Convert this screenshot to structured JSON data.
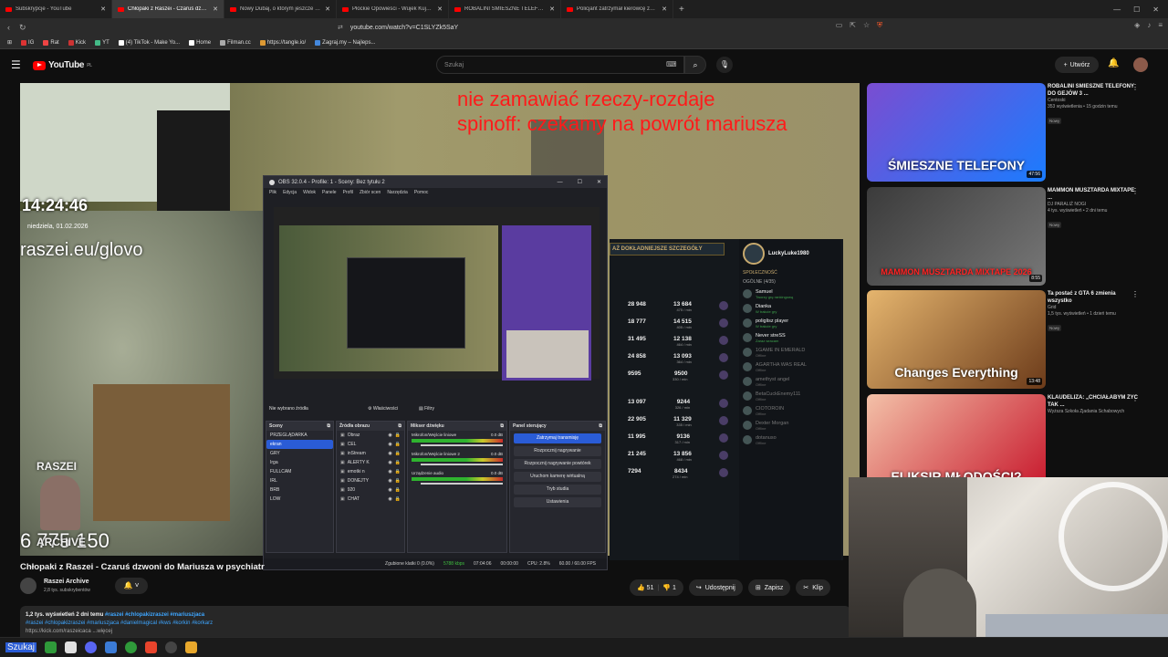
{
  "browser": {
    "tabs": [
      {
        "title": "Subskrypcje - YouTube",
        "active": false
      },
      {
        "title": "Chłopaki z Raszei - Czaruś dzwoni",
        "active": true
      },
      {
        "title": "Nowy Dubaj, o którym jeszcze nie sł",
        "active": false
      },
      {
        "title": "Płockie Opowieści - Wujek Kujek - Yo",
        "active": false
      },
      {
        "title": "ROBALINI ŚMIESZNE TELEFONY DO",
        "active": false
      },
      {
        "title": "Policjant zatrzymał kierowcę za prędk",
        "active": false
      }
    ],
    "url": "youtube.com/watch?v=C1SLYZk5SaY",
    "bookmarks": [
      "IG",
      "Rat",
      "Kick",
      "YT",
      "(4) TikTok - Make Yo...",
      "Home",
      "Filman.cc",
      "https://tangle.io/",
      "Zagraj.my – Najleps..."
    ]
  },
  "youtube": {
    "logo": "YouTube",
    "logo_region": "PL",
    "search_placeholder": "Szukaj",
    "create_label": "Utwórz"
  },
  "stream_overlay": {
    "line1": "nie zamawiać rzeczy-rozdaje",
    "line2": "spinoff: czekamy na powrót mariusza",
    "time": "14:24:46",
    "date": "niedziela, 01.02.2026",
    "site": "raszei.eu/glovo",
    "streamer": "RASZEI",
    "archive": "ARCHIVE",
    "counter": "6 775 150"
  },
  "obs": {
    "title": "OBS 32.0.4 - Profile: 1 - Sceny: Bez tytułu 2",
    "menu": [
      "Plik",
      "Edycja",
      "Widok",
      "Panele",
      "Profil",
      "Zbiór scen",
      "Narzędzia",
      "Pomoc"
    ],
    "no_source": "Nie wybrano źródła",
    "properties": "Właściwości",
    "filters": "Filtry",
    "docks": {
      "scenes": "Sceny",
      "sources": "Źródła obrazu",
      "mixer": "Mikser dźwięku",
      "controls": "Panel sterujący"
    },
    "scenes": [
      "PRZEGLĄDARKA",
      "ekran",
      "GRY",
      "Irga",
      "FULLCAM",
      "IRL",
      "BRB",
      "LOW"
    ],
    "sources": [
      "Obraz",
      "CEL",
      "inStream",
      "ALERTY K",
      "emotki n",
      "DONEJTY",
      "920",
      "CHAT"
    ],
    "mixer": [
      {
        "name": "Mikrofon/Wejście liniowe",
        "db": "0.0 dB"
      },
      {
        "name": "Mikrofon/Wejście liniowe 2",
        "db": "0.0 dB"
      },
      {
        "name": "Urządzenie audio",
        "db": "0.0 dB"
      }
    ],
    "controls": [
      "Zatrzymaj transmisję",
      "Rozpocznij nagrywanie",
      "Rozpocznij nagrywanie powtórek",
      "Uruchom kamerę wirtualną",
      "Tryb studia",
      "Ustawienia"
    ],
    "status": {
      "dropped": "Zgubione klatki 0 (0.0%)",
      "bitrate": "5788 kbps",
      "live": "07:04:06",
      "rec": "00:00:00",
      "cpu": "CPU: 2.8%",
      "fps": "60.00 / 60.00 FPS"
    }
  },
  "game": {
    "banner": "AŻ DOKŁADNIEJSZE SZCZEGÓŁY",
    "user": "LuckyLuke1980",
    "rows": [
      {
        "a": "28 948",
        "b": "13 684",
        "s": "475 / min"
      },
      {
        "a": "18 777",
        "b": "14 515",
        "s": "405 / min"
      },
      {
        "a": "31 495",
        "b": "12 138",
        "s": "464 / min"
      },
      {
        "a": "24 858",
        "b": "13 093",
        "s": "364 / min"
      },
      {
        "a": "9595",
        "b": "9500",
        "s": "330 / min"
      },
      {
        "a": "13 097",
        "b": "9244",
        "s": "326 / min"
      },
      {
        "a": "22 905",
        "b": "11 329",
        "s": "335 / min"
      },
      {
        "a": "11 995",
        "b": "9136",
        "s": "317 / min"
      },
      {
        "a": "21 245",
        "b": "13 856",
        "s": "468 / min"
      },
      {
        "a": "7294",
        "b": "8434",
        "s": "274 / min"
      }
    ],
    "friends_header": "SPOŁECZNOŚĆ",
    "friends_group": "OGÓLNE (4/35)",
    "friends": [
      {
        "name": "Samuel",
        "status": "Tworzy grę rankingową",
        "on": true
      },
      {
        "name": "Dianka",
        "status": "W trakcie gry",
        "on": true
      },
      {
        "name": "poliglisz player",
        "status": "W trakcie gry",
        "on": true
      },
      {
        "name": "Never streSS",
        "status": "Zaraz wracam",
        "on": true
      },
      {
        "name": "1GAME IN EMERALD",
        "status": "Offline",
        "on": false
      },
      {
        "name": "AGARTHA WAS REAL",
        "status": "Offline",
        "on": false
      },
      {
        "name": "amethyst angel",
        "status": "Offline",
        "on": false
      },
      {
        "name": "BetaCuckEnemy111",
        "status": "Offline",
        "on": false
      },
      {
        "name": "CIOTOROIN",
        "status": "Offline",
        "on": false
      },
      {
        "name": "Dexter Morgan",
        "status": "Offline",
        "on": false
      },
      {
        "name": "dotanuso",
        "status": "Offline",
        "on": false
      }
    ]
  },
  "video": {
    "title": "Chłopaki z Raszei - Czaruś dzwoni do Mariusza w psychiatr",
    "channel": "Raszei Archive",
    "subs": "2,8 tys. subskrybentów",
    "likes": "51",
    "dislikes": "1",
    "share": "Udostępnij",
    "save": "Zapisz",
    "clip": "Klip",
    "stats": "1,2 tys. wyświetleń  2 dni temu",
    "tags_line1": "#raszei #chlopakizraszei #mariuszjaca",
    "tags_line2": "#raszei #chlopakizraszei #mariuszjaca #danielmagical #kws #korkin #korkarz",
    "link": "https://kick.com/raszeicaca ...więcej"
  },
  "sidebar": [
    {
      "title": "ROBALINI ŚMIESZNE TELEFONY DO GEJÓW 3 ...",
      "channel": "Centoski",
      "meta": "353 wyświetlenia • 15 godzin temu",
      "badge": "Nowy",
      "thumb_text": "ŚMIESZNE TELEFONY",
      "duration": "47:56",
      "colors": [
        "#7a4dd1",
        "#1a7cff"
      ]
    },
    {
      "title": "MAMMON MUSZTARDA MIXTAPE ...",
      "channel": "DJ PARALIŻ NOGI",
      "meta": "4 tys. wyświetleń • 2 dni temu",
      "badge": "Nowy",
      "thumb_text": "MAMMON MUSZTARDA MIXTAPE 2026",
      "duration": "8:55",
      "colors": [
        "#3b3b3b",
        "#777"
      ]
    },
    {
      "title": "Ta postać z GTA 6 zmienia wszystko",
      "channel": "Grid",
      "meta": "1,5 tys. wyświetleń • 1 dzień temu",
      "badge": "Nowy",
      "thumb_text": "Changes Everything",
      "duration": "13:48",
      "colors": [
        "#e5b56e",
        "#6c3b1a"
      ]
    },
    {
      "title": "KLAUDELIZA: „CHCIAŁABYM ŻYĆ TAK ...",
      "channel": "Wyższa Szkoła Zjadania Schabowych",
      "meta": "",
      "badge": "",
      "thumb_text": "ELIKSIR MŁODOŚCI?",
      "duration": "",
      "colors": [
        "#f3c1a8",
        "#c7162b"
      ]
    }
  ],
  "taskbar": {
    "search": "Szukaj"
  }
}
